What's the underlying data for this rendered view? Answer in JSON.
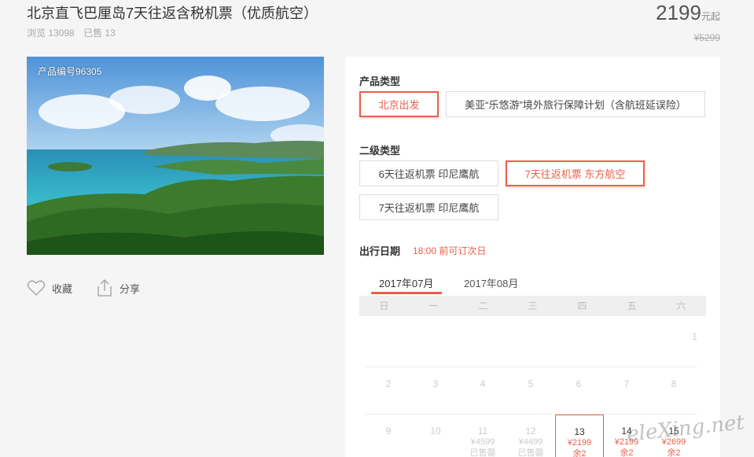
{
  "header": {
    "title": "北京直飞巴厘岛7天往返含税机票（优质航空）",
    "views": "浏览 13098",
    "sold": "已售 13",
    "price": "2199",
    "price_unit": "元起",
    "orig_price": "¥5299"
  },
  "hero": {
    "product_no": "产品编号96305"
  },
  "actions": {
    "favorite": "收藏",
    "share": "分享"
  },
  "panel": {
    "product_type_label": "产品类型",
    "product_types": [
      "北京出发",
      "美亚“乐悠游”境外旅行保障计划（含航班延误险）"
    ],
    "sub_type_label": "二级类型",
    "sub_types": [
      "6天往返机票 印尼鹰航",
      "7天往返机票 东方航空",
      "7天往返机票 印尼鹰航"
    ],
    "date_label": "出行日期",
    "date_note": "18:00 前可订次日",
    "months": [
      "2017年07月",
      "2017年08月"
    ],
    "weekdays": [
      "日",
      "一",
      "二",
      "三",
      "四",
      "五",
      "六"
    ],
    "calendar": {
      "row1": {
        "d1": "1"
      },
      "row2": [
        "2",
        "3",
        "4",
        "5",
        "6",
        "7",
        "8"
      ],
      "row3": {
        "d9": "9",
        "d10": "10",
        "d11": "11",
        "d11_price": "¥4599",
        "d11_status": "已售罄",
        "d12": "12",
        "d12_price": "¥4499",
        "d12_status": "已售罄",
        "d13": "13",
        "d13_price": "¥2199",
        "d13_status": "余2",
        "d14": "14",
        "d14_price": "¥2199",
        "d14_status": "余2",
        "d15": "15",
        "d15_price": "¥2699",
        "d15_status": "余2"
      }
    }
  },
  "watermark": "eleXing.net",
  "colors": {
    "accent": "#e8604a"
  }
}
